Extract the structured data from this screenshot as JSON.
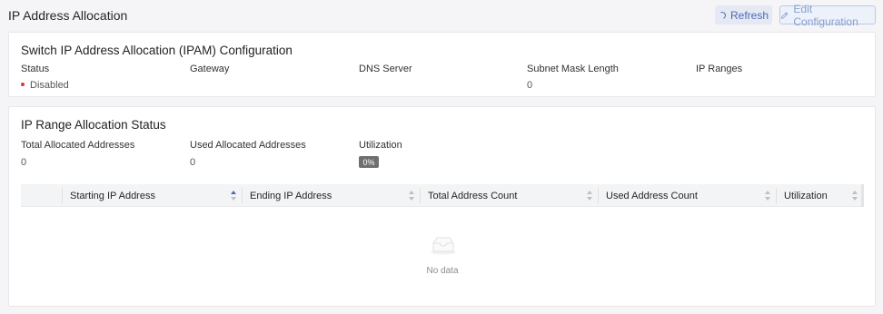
{
  "header": {
    "title": "IP Address Allocation",
    "refresh_label": "Refresh",
    "edit_label": "Edit Configuration"
  },
  "ipam": {
    "title": "Switch IP Address Allocation (IPAM) Configuration",
    "fields": [
      {
        "label": "Status",
        "value": "Disabled"
      },
      {
        "label": "Gateway",
        "value": ""
      },
      {
        "label": "DNS Server",
        "value": ""
      },
      {
        "label": "Subnet Mask Length",
        "value": "0"
      },
      {
        "label": "IP Ranges",
        "value": ""
      }
    ],
    "status_color": "#d9363e"
  },
  "range_status": {
    "title": "IP Range Allocation Status",
    "stats": [
      {
        "label": "Total Allocated Addresses",
        "value": "0"
      },
      {
        "label": "Used Allocated Addresses",
        "value": "0"
      },
      {
        "label": "Utilization",
        "value": "0%"
      }
    ]
  },
  "table": {
    "columns": [
      {
        "label": "Starting IP Address",
        "sort": "ascending"
      },
      {
        "label": "Ending IP Address",
        "sort": "none"
      },
      {
        "label": "Total Address Count",
        "sort": "none"
      },
      {
        "label": "Used Address Count",
        "sort": "none"
      },
      {
        "label": "Utilization",
        "sort": "none"
      }
    ],
    "rows": [],
    "empty_text": "No data"
  },
  "colors": {
    "accent": "#4a6bb6",
    "badge": "#6f6f6f"
  }
}
